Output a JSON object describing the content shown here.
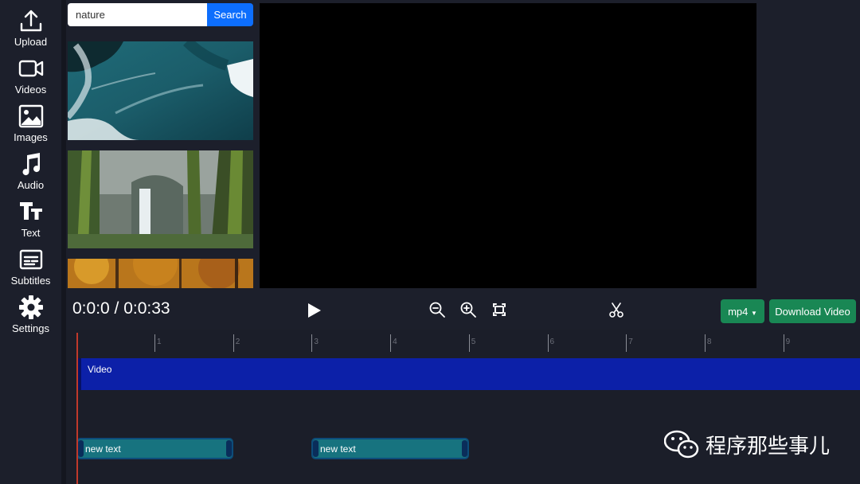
{
  "sidebar": {
    "items": [
      {
        "label": "Upload",
        "icon": "upload-icon"
      },
      {
        "label": "Videos",
        "icon": "video-camera-icon"
      },
      {
        "label": "Images",
        "icon": "image-icon"
      },
      {
        "label": "Audio",
        "icon": "music-note-icon"
      },
      {
        "label": "Text",
        "icon": "text-icon"
      },
      {
        "label": "Subtitles",
        "icon": "subtitles-icon"
      },
      {
        "label": "Settings",
        "icon": "gear-icon"
      }
    ]
  },
  "search": {
    "value": "nature",
    "button_label": "Search"
  },
  "thumbnails": [
    {
      "icon": "ocean-waves-thumbnail"
    },
    {
      "icon": "forest-waterfall-thumbnail"
    },
    {
      "icon": "autumn-forest-thumbnail"
    }
  ],
  "toolbar": {
    "time_display": "0:0:0 / 0:0:33",
    "format_label": "mp4",
    "download_label": "Download Video",
    "icons": [
      "play-icon",
      "zoom-out-icon",
      "zoom-in-icon",
      "fit-icon",
      "scissors-icon"
    ]
  },
  "timeline": {
    "ruler_labels": [
      "1",
      "2",
      "3",
      "4",
      "5",
      "6",
      "7",
      "8",
      "9"
    ],
    "video_track_label": "Video",
    "text_clips": [
      {
        "label": "new text"
      },
      {
        "label": "new text"
      }
    ]
  },
  "watermark": {
    "text": "程序那些事儿"
  },
  "colors": {
    "background": "#1c1f2b",
    "primary": "#0d6efd",
    "success": "#198754",
    "video_track": "#0c20a8",
    "text_clip": "#17737f",
    "playhead": "#c0392b"
  }
}
